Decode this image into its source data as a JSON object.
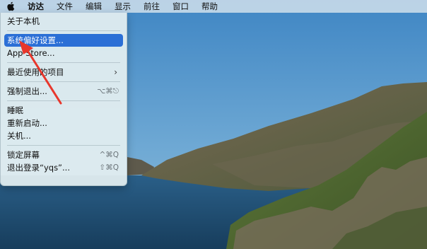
{
  "menubar": {
    "apple_icon": "apple-logo-icon",
    "items": [
      "访达",
      "文件",
      "编辑",
      "显示",
      "前往",
      "窗口",
      "帮助"
    ]
  },
  "apple_menu": {
    "about": "关于本机",
    "system_preferences": "系统偏好设置...",
    "app_store": "App Store...",
    "recent_items": "最近使用的项目",
    "recent_items_arrow": "›",
    "force_quit": "强制退出...",
    "force_quit_shortcut": "⌥⌘⎋",
    "sleep": "睡眠",
    "restart": "重新启动...",
    "shutdown": "关机...",
    "lock_screen": "锁定屏幕",
    "lock_screen_shortcut": "^⌘Q",
    "logout": "退出登录“yqs”...",
    "logout_shortcut": "⇧⌘Q"
  },
  "colors": {
    "highlight": "#2b6fd6",
    "annotation_arrow": "#e8372c"
  }
}
